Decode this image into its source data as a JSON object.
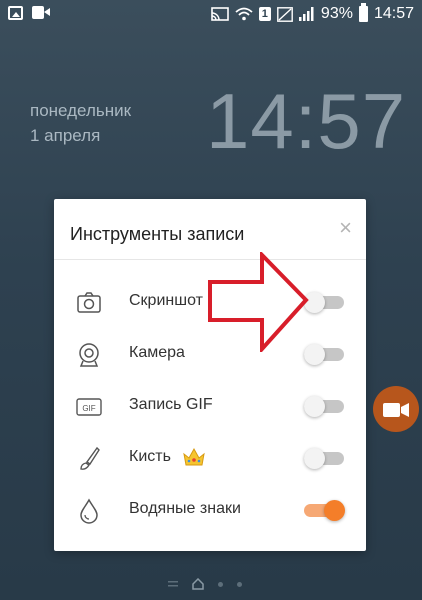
{
  "status_bar": {
    "wifi_sim": "1",
    "battery_percent": "93%",
    "time": "14:57"
  },
  "lockscreen": {
    "weekday": "понедельник",
    "date": "1 апреля",
    "clock": "14:57"
  },
  "dialog": {
    "title": "Инструменты записи",
    "close_glyph": "×",
    "items": [
      {
        "icon": "camera-icon",
        "label": "Скриншот",
        "enabled": false
      },
      {
        "icon": "webcam-icon",
        "label": "Камера",
        "enabled": false
      },
      {
        "icon": "gif-icon",
        "label": "Запись GIF",
        "enabled": false
      },
      {
        "icon": "brush-icon",
        "label": "Кисть",
        "enabled": false,
        "badge": "crown-icon"
      },
      {
        "icon": "watermark-drop-icon",
        "label": "Водяные знаки",
        "enabled": true
      }
    ]
  },
  "colors": {
    "accent": "#f47e29",
    "arrow_outline": "#d81e2a",
    "floating_button": "#b7561c"
  }
}
